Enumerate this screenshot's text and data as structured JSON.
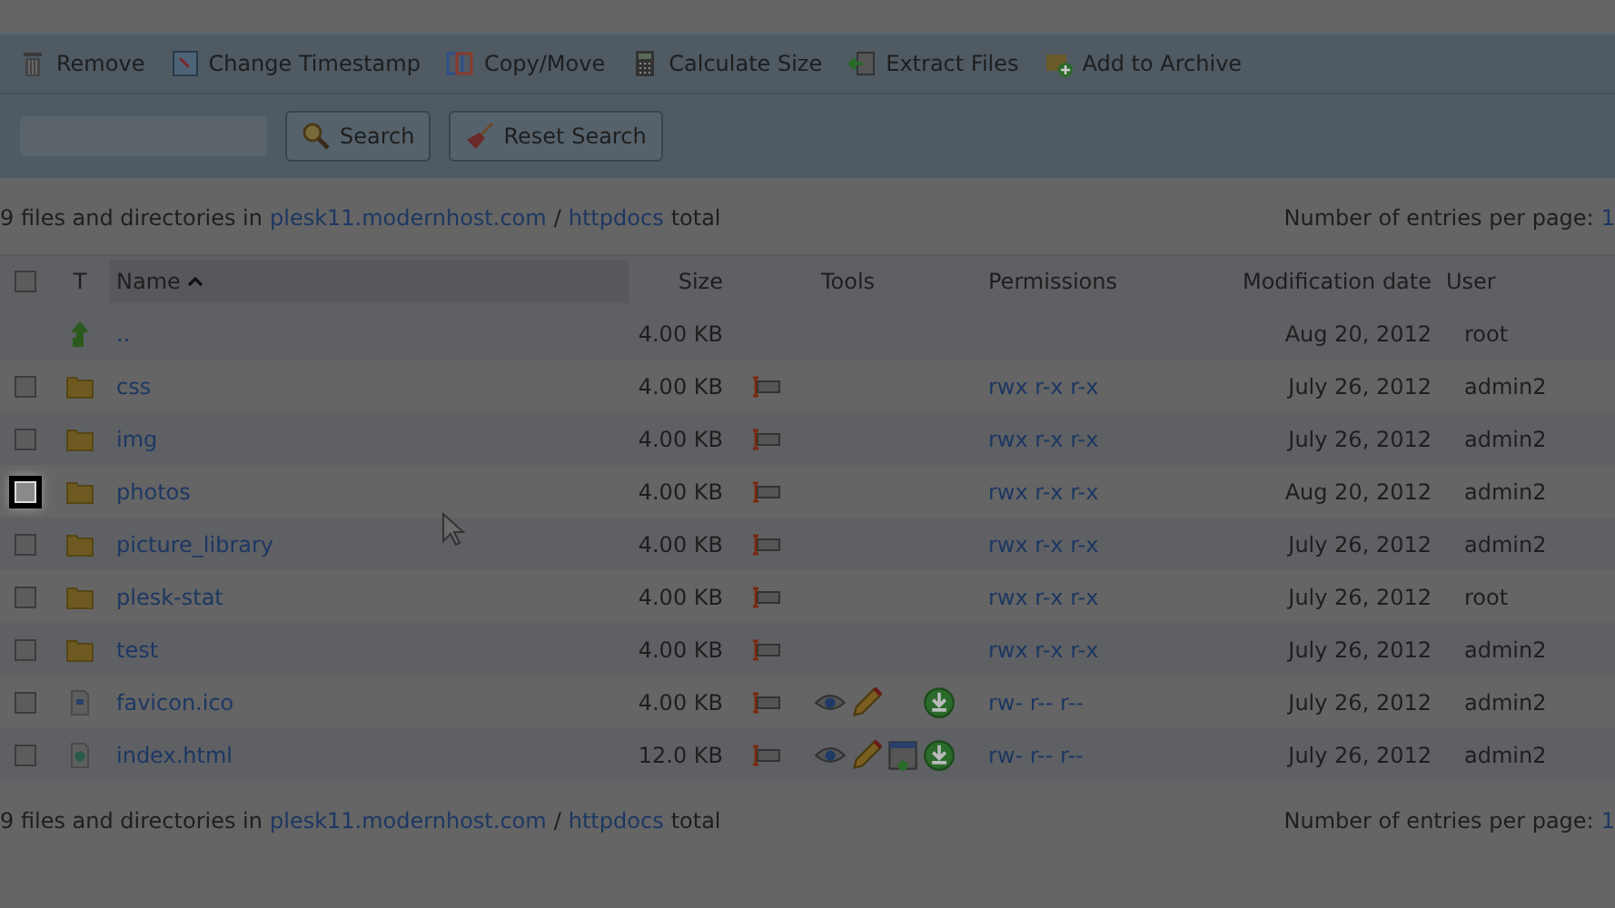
{
  "toolbar": {
    "buttons": [
      {
        "kind": "remove",
        "label": "Remove"
      },
      {
        "kind": "timestamp",
        "label": "Change Timestamp"
      },
      {
        "kind": "copy",
        "label": "Copy/Move"
      },
      {
        "kind": "calc",
        "label": "Calculate Size"
      },
      {
        "kind": "extract",
        "label": "Extract Files"
      },
      {
        "kind": "archive",
        "label": "Add to Archive"
      }
    ]
  },
  "search": {
    "buttons": [
      {
        "kind": "search",
        "label": "Search"
      },
      {
        "kind": "reset",
        "label": "Reset Search"
      }
    ]
  },
  "summary_top": {
    "count_text": "9 files and directories in",
    "domain": "plesk11.modernhost.com",
    "separator": "/",
    "folder": "httpdocs",
    "suffix": "total",
    "per_page_label": "Number of entries per page:",
    "per_page_value": "1"
  },
  "table": {
    "header_checkbox": {
      "checked": false
    },
    "columns": [
      {
        "label": "T",
        "sorted": false
      },
      {
        "label": "Name",
        "sorted": true
      },
      {
        "label": "Size",
        "sorted": false
      },
      {
        "label": "Tools",
        "sorted": false
      },
      {
        "label": "Permissions",
        "sorted": false
      },
      {
        "label": "Modification date",
        "sorted": false
      },
      {
        "label": "User",
        "sorted": false
      }
    ],
    "rows": [
      {
        "kind": "up",
        "name": "..",
        "size": "4.00 KB",
        "tools": [],
        "date": "Aug 20, 2012",
        "user": "root"
      },
      {
        "kind": "folder",
        "name": "css",
        "size": "4.00 KB",
        "tools": [],
        "permissions": "rwx r-x r-x",
        "date": "July 26, 2012",
        "user": "admin2",
        "checked": false,
        "highlighted": false
      },
      {
        "kind": "folder",
        "name": "img",
        "size": "4.00 KB",
        "tools": [],
        "permissions": "rwx r-x r-x",
        "date": "July 26, 2012",
        "user": "admin2",
        "checked": false,
        "highlighted": false
      },
      {
        "kind": "folder",
        "name": "photos",
        "size": "4.00 KB",
        "tools": [],
        "permissions": "rwx r-x r-x",
        "date": "Aug 20, 2012",
        "user": "admin2",
        "checked": false,
        "highlighted": true
      },
      {
        "kind": "folder",
        "name": "picture_library",
        "size": "4.00 KB",
        "tools": [],
        "permissions": "rwx r-x r-x",
        "date": "July 26, 2012",
        "user": "admin2",
        "checked": false,
        "highlighted": false
      },
      {
        "kind": "folder",
        "name": "plesk-stat",
        "size": "4.00 KB",
        "tools": [],
        "permissions": "rwx r-x r-x",
        "date": "July 26, 2012",
        "user": "root",
        "checked": false,
        "highlighted": false
      },
      {
        "kind": "folder",
        "name": "test",
        "size": "4.00 KB",
        "tools": [],
        "permissions": "rwx r-x r-x",
        "date": "July 26, 2012",
        "user": "admin2",
        "checked": false,
        "highlighted": false
      },
      {
        "kind": "image",
        "name": "favicon.ico",
        "size": "4.00 KB",
        "tools": [
          {
            "kind": "view"
          },
          {
            "kind": "edit"
          },
          {
            "kind": "none"
          },
          {
            "kind": "download"
          }
        ],
        "permissions": "rw- r-- r--",
        "date": "July 26, 2012",
        "user": "admin2",
        "checked": false,
        "highlighted": false
      },
      {
        "kind": "html",
        "name": "index.html",
        "size": "12.0 KB",
        "tools": [
          {
            "kind": "view"
          },
          {
            "kind": "edit"
          },
          {
            "kind": "preview"
          },
          {
            "kind": "download"
          }
        ],
        "permissions": "rw- r-- r--",
        "date": "July 26, 2012",
        "user": "admin2",
        "checked": false,
        "highlighted": false
      }
    ]
  },
  "summary_bottom": {
    "count_text": "9 files and directories in",
    "domain": "plesk11.modernhost.com",
    "separator": "/",
    "folder": "httpdocs",
    "suffix": "total",
    "per_page_label": "Number of entries per page:",
    "per_page_value": "1"
  }
}
